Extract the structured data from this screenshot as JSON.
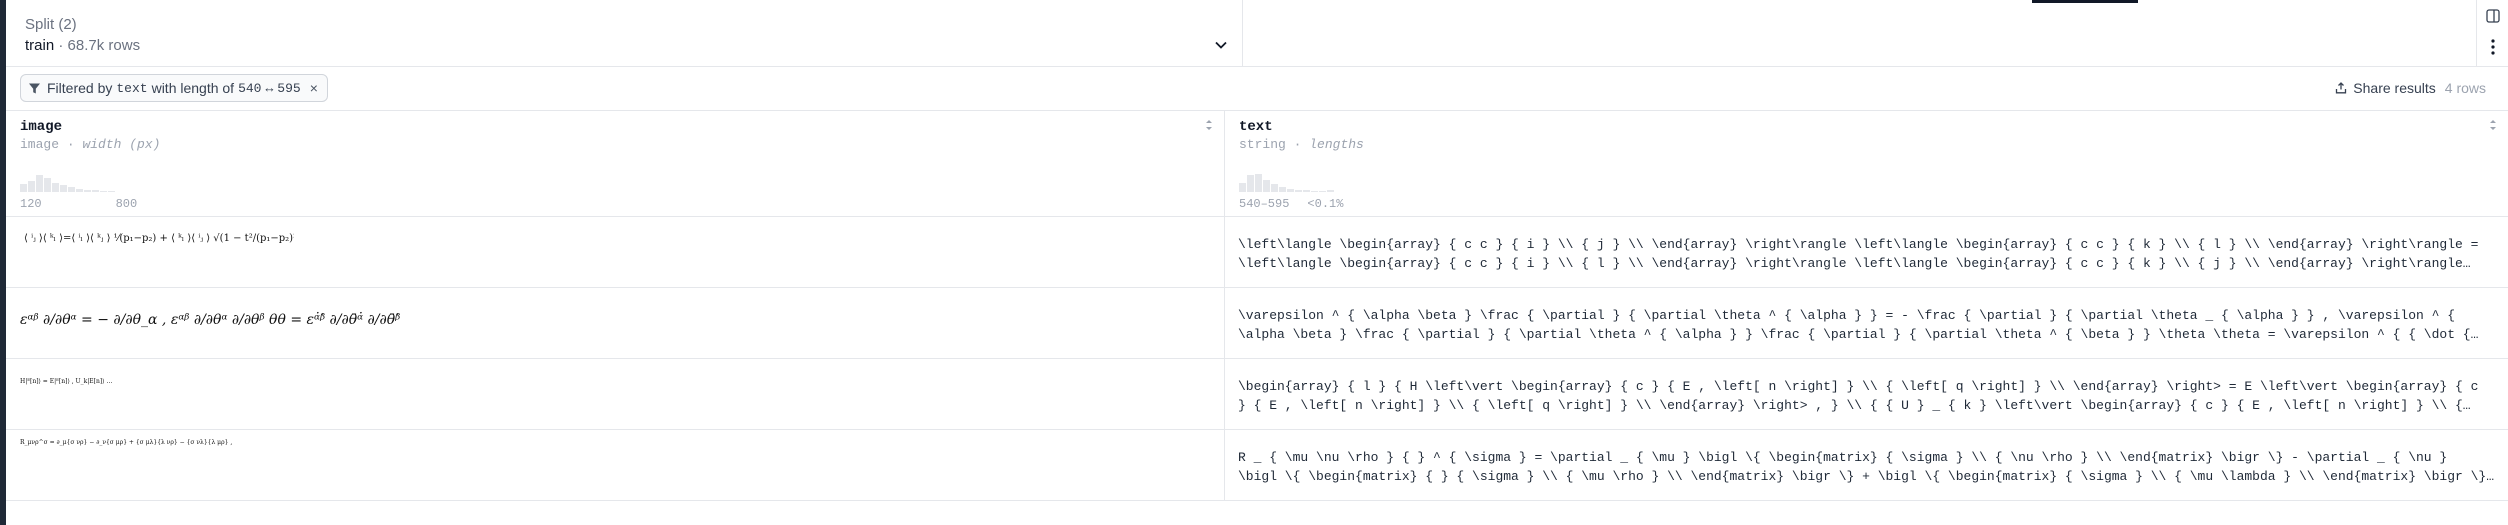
{
  "split": {
    "title": "Split (2)",
    "name": "train",
    "separator": "·",
    "rows": "68.7k rows"
  },
  "filter": {
    "prefix": "Filtered by",
    "column": "text",
    "middle": "with length of",
    "range_from": "540",
    "range_arrow": "↔",
    "range_to": "595",
    "close": "×"
  },
  "share": {
    "label": "Share results",
    "count": "4 rows"
  },
  "columns": [
    {
      "name": "image",
      "type": "image",
      "sep": "·",
      "stat": "width (px)",
      "hist_left": "120",
      "hist_right": "800",
      "hist_values": [
        0.25,
        0.35,
        0.55,
        0.45,
        0.3,
        0.22,
        0.15,
        0.1,
        0.07,
        0.05,
        0.04,
        0.03
      ]
    },
    {
      "name": "text",
      "type": "string",
      "sep": "·",
      "stat": "lengths",
      "hist_left": "540–595",
      "hist_right": "<0.1%",
      "hist_values": [
        0.3,
        0.55,
        0.6,
        0.4,
        0.25,
        0.15,
        0.1,
        0.06,
        0.05,
        0.04,
        0.03,
        0.05
      ]
    }
  ],
  "rows": [
    {
      "image_text": "⟨ ⁱⱼ ⟩⟨ ᵏₗ ⟩=⟨ ⁱₗ ⟩⟨ ᵏⱼ ⟩ ¹⁄(p₁−p₂) + ⟨ ᵏₗ ⟩⟨ ⁱⱼ ⟩ √(1 − t²/(p₁−p₂)²)",
      "text_line1": "\\left\\langle \\begin{array} { c c } { i } \\\\ { j } \\\\ \\end{array} \\right\\rangle \\left\\langle \\begin{array} { c c } { k } \\\\ { l } \\\\ \\end{array} \\right\\rangle =",
      "text_line2": "\\left\\langle \\begin{array} { c c } { i } \\\\ { l } \\\\ \\end{array} \\right\\rangle \\left\\langle \\begin{array} { c c } { k } \\\\ { j } \\\\ \\end{array} \\right\\rangle…"
    },
    {
      "image_text": "εᵅᵝ ∂/∂θᵅ = − ∂/∂θ_α , εᵅᵝ ∂/∂θᵅ ∂/∂θᵝ θθ = εᵅ̇ᵝ̇ ∂/∂θ̄ᵅ̇ ∂/∂θ̄ᵝ̇ θ̄θ̄ = 4.",
      "text_line1": "\\varepsilon ^ { \\alpha \\beta } \\frac { \\partial } { \\partial \\theta ^ { \\alpha } } = - \\frac { \\partial } { \\partial \\theta _ { \\alpha } } , \\varepsilon ^ {",
      "text_line2": "\\alpha \\beta } \\frac { \\partial } { \\partial \\theta ^ { \\alpha } } \\frac { \\partial } { \\partial \\theta ^ { \\beta } } \\theta \\theta = \\varepsilon ^ { { \\dot {…"
    },
    {
      "image_text": "H|ᴱ[n]⟩ = E|ᴱ[n]⟩ , U_k|E[n]⟩ …",
      "text_line1": "\\begin{array} { l } { H \\left\\vert \\begin{array} { c } { E , \\left[ n \\right] } \\\\ { \\left[ q \\right] } \\\\ \\end{array} \\right> = E \\left\\vert \\begin{array} { c",
      "text_line2": "} { E , \\left[ n \\right] } \\\\ { \\left[ q \\right] } \\\\ \\end{array} \\right> , } \\\\ { { U } _ { k } \\left\\vert \\begin{array} { c } { E , \\left[ n \\right] } \\\\ {…"
    },
    {
      "image_text": "R_μνρ^σ = ∂_μ{σ νρ} − ∂_ν{σ μρ} + {σ μλ}{λ νρ} − {σ νλ}{λ μρ} ,",
      "text_line1": "R _ { \\mu \\nu \\rho } { } ^ { \\sigma } = \\partial _ { \\mu } \\bigl \\{ \\begin{matrix} { \\sigma } \\\\ { \\nu \\rho } \\\\ \\end{matrix} \\bigr \\} - \\partial _ { \\nu }",
      "text_line2": "\\bigl \\{ \\begin{matrix} { } { \\sigma } \\\\ { \\mu \\rho } \\\\ \\end{matrix} \\bigr \\} + \\bigl \\{ \\begin{matrix} { \\sigma } \\\\ { \\mu \\lambda } \\\\ \\end{matrix} \\bigr \\}…"
    }
  ]
}
